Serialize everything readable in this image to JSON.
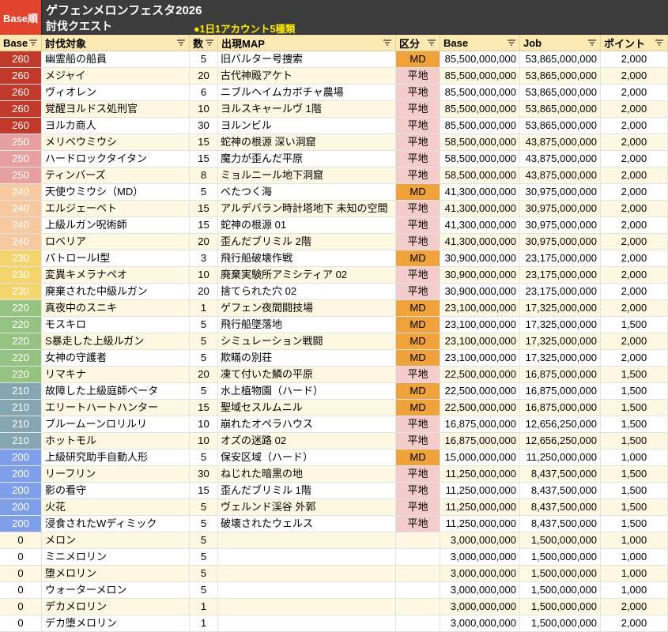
{
  "title_bar": {
    "sort_label": "Base順",
    "event_title": "ゲフェンメロンフェスタ2026",
    "subtitle": "討伐クエスト",
    "note": "●1日1アカウント5種類"
  },
  "columns": [
    {
      "key": "level",
      "label": "Base"
    },
    {
      "key": "target",
      "label": "討伐対象"
    },
    {
      "key": "count",
      "label": "数"
    },
    {
      "key": "map",
      "label": "出現MAP"
    },
    {
      "key": "type",
      "label": "区分"
    },
    {
      "key": "base_exp",
      "label": "Base"
    },
    {
      "key": "job_exp",
      "label": "Job"
    },
    {
      "key": "points",
      "label": "ポイント"
    }
  ],
  "icons": {
    "column_filter": "filter-icon"
  },
  "colors": {
    "title_bg": "#3c3c3c",
    "sort_label_bg": "#e2452e",
    "note_color": "#ffeb00",
    "header_bg": "#fce8b2",
    "row_bg": "#ffffff",
    "row_alt_bg": "#fef8e3",
    "level_colors": {
      "260": "#c0392b",
      "250": "#e6a0a0",
      "240": "#f6c9a0",
      "230": "#f4d46c",
      "220": "#96c281",
      "210": "#86a5b2",
      "200": "#7f9fea"
    },
    "type_colors": {
      "MD": "#f1a33b",
      "平地": "#f4cccc"
    }
  },
  "rows": [
    {
      "level": "260",
      "target": "幽霊船の船員",
      "count": "5",
      "map": "旧バルター号捜索",
      "type": "MD",
      "base_exp": "85,500,000,000",
      "job_exp": "53,865,000,000",
      "points": "2,000"
    },
    {
      "level": "260",
      "target": "メジャイ",
      "count": "20",
      "map": "古代神殿アケト",
      "type": "平地",
      "base_exp": "85,500,000,000",
      "job_exp": "53,865,000,000",
      "points": "2,000"
    },
    {
      "level": "260",
      "target": "ヴィオレン",
      "count": "6",
      "map": "ニブルヘイムカボチャ農場",
      "type": "平地",
      "base_exp": "85,500,000,000",
      "job_exp": "53,865,000,000",
      "points": "2,000"
    },
    {
      "level": "260",
      "target": "覚醒ヨルドス処刑官",
      "count": "10",
      "map": "ヨルスキャールヴ 1階",
      "type": "平地",
      "base_exp": "85,500,000,000",
      "job_exp": "53,865,000,000",
      "points": "2,000"
    },
    {
      "level": "260",
      "target": "ヨルカ商人",
      "count": "30",
      "map": "ヨルンビル",
      "type": "平地",
      "base_exp": "85,500,000,000",
      "job_exp": "53,865,000,000",
      "points": "2,000"
    },
    {
      "level": "250",
      "target": "メリベウミウシ",
      "count": "15",
      "map": "蛇神の根源 深い洞窟",
      "type": "平地",
      "base_exp": "58,500,000,000",
      "job_exp": "43,875,000,000",
      "points": "2,000"
    },
    {
      "level": "250",
      "target": "ハードロックタイタン",
      "count": "15",
      "map": "魔力が歪んだ平原",
      "type": "平地",
      "base_exp": "58,500,000,000",
      "job_exp": "43,875,000,000",
      "points": "2,000"
    },
    {
      "level": "250",
      "target": "ティンバーズ",
      "count": "8",
      "map": "ミョルニール地下洞窟",
      "type": "平地",
      "base_exp": "58,500,000,000",
      "job_exp": "43,875,000,000",
      "points": "2,000"
    },
    {
      "level": "240",
      "target": "天使ウミウシ（MD）",
      "count": "5",
      "map": "べたつく海",
      "type": "MD",
      "base_exp": "41,300,000,000",
      "job_exp": "30,975,000,000",
      "points": "2,000"
    },
    {
      "level": "240",
      "target": "エルジェーベト",
      "count": "15",
      "map": "アルデバラン時計塔地下 未知の空間",
      "type": "平地",
      "base_exp": "41,300,000,000",
      "job_exp": "30,975,000,000",
      "points": "2,000"
    },
    {
      "level": "240",
      "target": "上級ルガン呪術師",
      "count": "15",
      "map": "蛇神の根源 01",
      "type": "平地",
      "base_exp": "41,300,000,000",
      "job_exp": "30,975,000,000",
      "points": "2,000"
    },
    {
      "level": "240",
      "target": "ロベリア",
      "count": "20",
      "map": "歪んだブリミル 2階",
      "type": "平地",
      "base_exp": "41,300,000,000",
      "job_exp": "30,975,000,000",
      "points": "2,000"
    },
    {
      "level": "230",
      "target": "パトロールⅠ型",
      "count": "3",
      "map": "飛行船破壊作戦",
      "type": "MD",
      "base_exp": "30,900,000,000",
      "job_exp": "23,175,000,000",
      "points": "2,000"
    },
    {
      "level": "230",
      "target": "変異キメラナペオ",
      "count": "10",
      "map": "廃棄実験所アミシティア 02",
      "type": "平地",
      "base_exp": "30,900,000,000",
      "job_exp": "23,175,000,000",
      "points": "2,000"
    },
    {
      "level": "230",
      "target": "廃棄された中級ルガン",
      "count": "20",
      "map": "捨てられた穴 02",
      "type": "平地",
      "base_exp": "30,900,000,000",
      "job_exp": "23,175,000,000",
      "points": "2,000"
    },
    {
      "level": "220",
      "target": "真夜中のスニキ",
      "count": "1",
      "map": "ゲフェン夜間闘技場",
      "type": "MD",
      "base_exp": "23,100,000,000",
      "job_exp": "17,325,000,000",
      "points": "2,000"
    },
    {
      "level": "220",
      "target": "モスキロ",
      "count": "5",
      "map": "飛行船墜落地",
      "type": "MD",
      "base_exp": "23,100,000,000",
      "job_exp": "17,325,000,000",
      "points": "1,500"
    },
    {
      "level": "220",
      "target": "S暴走した上級ルガン",
      "count": "5",
      "map": "シミュレーション戦闘",
      "type": "MD",
      "base_exp": "23,100,000,000",
      "job_exp": "17,325,000,000",
      "points": "2,000"
    },
    {
      "level": "220",
      "target": "女神の守護者",
      "count": "5",
      "map": "欺瞞の別荘",
      "type": "MD",
      "base_exp": "23,100,000,000",
      "job_exp": "17,325,000,000",
      "points": "2,000"
    },
    {
      "level": "220",
      "target": "リマキナ",
      "count": "20",
      "map": "凍て付いた鱗の平原",
      "type": "平地",
      "base_exp": "22,500,000,000",
      "job_exp": "16,875,000,000",
      "points": "1,500"
    },
    {
      "level": "210",
      "target": "故障した上級庭師ベータ",
      "count": "5",
      "map": "水上植物園（ハード）",
      "type": "MD",
      "base_exp": "22,500,000,000",
      "job_exp": "16,875,000,000",
      "points": "1,500"
    },
    {
      "level": "210",
      "target": "エリートハートハンター",
      "count": "15",
      "map": "聖域セスルムニル",
      "type": "MD",
      "base_exp": "22,500,000,000",
      "job_exp": "16,875,000,000",
      "points": "1,500"
    },
    {
      "level": "210",
      "target": "ブルームーンロリルリ",
      "count": "10",
      "map": "崩れたオペラハウス",
      "type": "平地",
      "base_exp": "16,875,000,000",
      "job_exp": "12,656,250,000",
      "points": "1,500"
    },
    {
      "level": "210",
      "target": "ホットモル",
      "count": "10",
      "map": "オズの迷路 02",
      "type": "平地",
      "base_exp": "16,875,000,000",
      "job_exp": "12,656,250,000",
      "points": "1,500"
    },
    {
      "level": "200",
      "target": "上級研究助手自動人形",
      "count": "5",
      "map": "保安区域（ハード）",
      "type": "MD",
      "base_exp": "15,000,000,000",
      "job_exp": "11,250,000,000",
      "points": "1,000"
    },
    {
      "level": "200",
      "target": "リーフリン",
      "count": "30",
      "map": "ねじれた暗黒の地",
      "type": "平地",
      "base_exp": "11,250,000,000",
      "job_exp": "8,437,500,000",
      "points": "1,500"
    },
    {
      "level": "200",
      "target": "影の看守",
      "count": "15",
      "map": "歪んだブリミル 1階",
      "type": "平地",
      "base_exp": "11,250,000,000",
      "job_exp": "8,437,500,000",
      "points": "1,500"
    },
    {
      "level": "200",
      "target": "火花",
      "count": "5",
      "map": "ヴェルンド渓谷 外郭",
      "type": "平地",
      "base_exp": "11,250,000,000",
      "job_exp": "8,437,500,000",
      "points": "1,500"
    },
    {
      "level": "200",
      "target": "浸食されたWディミック",
      "count": "5",
      "map": "破壊されたウェルス",
      "type": "平地",
      "base_exp": "11,250,000,000",
      "job_exp": "8,437,500,000",
      "points": "1,500"
    },
    {
      "level": "0",
      "target": "メロン",
      "count": "5",
      "base_exp": "3,000,000,000",
      "job_exp": "1,500,000,000",
      "points": "1,000"
    },
    {
      "level": "0",
      "target": "ミニメロリン",
      "count": "5",
      "base_exp": "3,000,000,000",
      "job_exp": "1,500,000,000",
      "points": "1,000"
    },
    {
      "level": "0",
      "target": "堕メロリン",
      "count": "5",
      "base_exp": "3,000,000,000",
      "job_exp": "1,500,000,000",
      "points": "1,000"
    },
    {
      "level": "0",
      "target": "ウォーターメロン",
      "count": "5",
      "base_exp": "3,000,000,000",
      "job_exp": "1,500,000,000",
      "points": "1,000"
    },
    {
      "level": "0",
      "target": "デカメロリン",
      "count": "1",
      "base_exp": "3,000,000,000",
      "job_exp": "1,500,000,000",
      "points": "2,000"
    },
    {
      "level": "0",
      "target": "デカ堕メロリン",
      "count": "1",
      "base_exp": "3,000,000,000",
      "job_exp": "1,500,000,000",
      "points": "2,000"
    }
  ]
}
